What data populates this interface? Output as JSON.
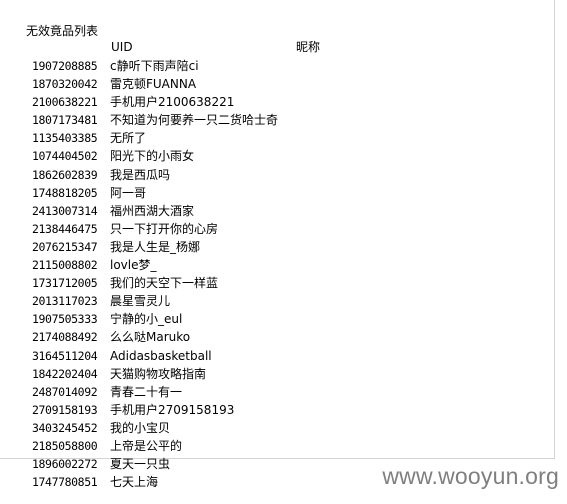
{
  "title": "无效竟品列表",
  "columns": {
    "uid": "UID",
    "nickname": "昵称"
  },
  "rows": [
    {
      "uid": "1907208885",
      "nickname": "c静听下雨声陪ci"
    },
    {
      "uid": "1870320042",
      "nickname": "雷克顿FUANNA"
    },
    {
      "uid": "2100638221",
      "nickname": "手机用户2100638221"
    },
    {
      "uid": "1807173481",
      "nickname": "不知道为何要养一只二货哈士奇"
    },
    {
      "uid": "1135403385",
      "nickname": "无所了"
    },
    {
      "uid": "1074404502",
      "nickname": "阳光下的小雨女"
    },
    {
      "uid": "1862602839",
      "nickname": "我是西瓜吗"
    },
    {
      "uid": "1748818205",
      "nickname": "阿一哥"
    },
    {
      "uid": "2413007314",
      "nickname": "福州西湖大酒家"
    },
    {
      "uid": "2138446475",
      "nickname": "只一下打开你的心房"
    },
    {
      "uid": "2076215347",
      "nickname": "我是人生是_杨娜"
    },
    {
      "uid": "2115008802",
      "nickname": "lovle梦_"
    },
    {
      "uid": "1731712005",
      "nickname": "我们的天空下一样蓝"
    },
    {
      "uid": "2013117023",
      "nickname": "晨星雪灵儿"
    },
    {
      "uid": "1907505333",
      "nickname": "宁静的小_eul"
    },
    {
      "uid": "2174088492",
      "nickname": "么么哒Maruko"
    },
    {
      "uid": "3164511204",
      "nickname": "Adidasbasketball"
    },
    {
      "uid": "1842202404",
      "nickname": "天猫购物攻略指南"
    },
    {
      "uid": "2487014092",
      "nickname": "青春二十有一"
    },
    {
      "uid": "2709158193",
      "nickname": "手机用户2709158193"
    },
    {
      "uid": "3403245452",
      "nickname": "我的小宝贝"
    },
    {
      "uid": "2185058800",
      "nickname": "上帝是公平的"
    },
    {
      "uid": "1896002272",
      "nickname": "夏天一只虫"
    },
    {
      "uid": "1747780851",
      "nickname": "七天上海"
    }
  ],
  "watermark": "www.wooyun.org"
}
